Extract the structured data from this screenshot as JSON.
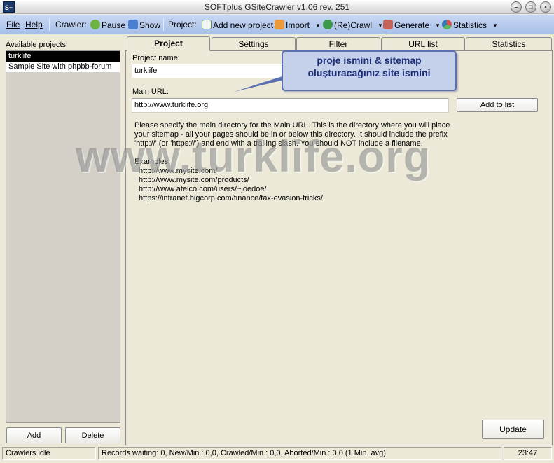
{
  "window": {
    "icon_text": "S+",
    "title": "SOFTplus GSiteCrawler v1.06 rev. 251"
  },
  "toolbar": {
    "file": "File",
    "help": "Help",
    "crawler_label": "Crawler:",
    "pause": "Pause",
    "show": "Show",
    "project_label": "Project:",
    "add_new_project": "Add new project",
    "import": "Import",
    "recrawl": "(Re)Crawl",
    "generate": "Generate",
    "statistics": "Statistics"
  },
  "left": {
    "label": "Available projects:",
    "projects": [
      "turklife",
      "Sample Site with phpbb-forum"
    ],
    "add": "Add",
    "delete": "Delete"
  },
  "tabs": [
    "Project",
    "Settings",
    "Filter",
    "URL list",
    "Statistics"
  ],
  "form": {
    "project_name_label": "Project name:",
    "project_name_value": "turklife",
    "main_url_label": "Main URL:",
    "main_url_value": "http://www.turklife.org",
    "add_to_list": "Add to list",
    "help_text": "Please specify the main directory for the Main URL. This is the directory where you will place your sitemap - all your pages should be in or below this directory. It should include the prefix 'http://' (or 'https://') and end with a trailing slash.  You should NOT include a filename.",
    "examples_label": "Examples:",
    "examples": [
      "http://www.mysite.com/",
      "http://www.mysite.com/products/",
      "http://www.atelco.com/users/~joedoe/",
      "https://intranet.bigcorp.com/finance/tax-evasion-tricks/"
    ],
    "update": "Update"
  },
  "callout": {
    "line1": "proje ismini & sitemap",
    "line2": "oluşturacağınız site ismini"
  },
  "watermark": "www.turklife.org",
  "status": {
    "state": "Crawlers idle",
    "records": "Records waiting: 0, New/Min.: 0,0, Crawled/Min.: 0,0, Aborted/Min.: 0,0 (1 Min. avg)",
    "time": "23:47"
  },
  "colors": {
    "toolbar_top": "#c9d8f3",
    "callout_bg": "#c5d1eb",
    "callout_text": "#1d2f7a",
    "selection": "#000000"
  }
}
